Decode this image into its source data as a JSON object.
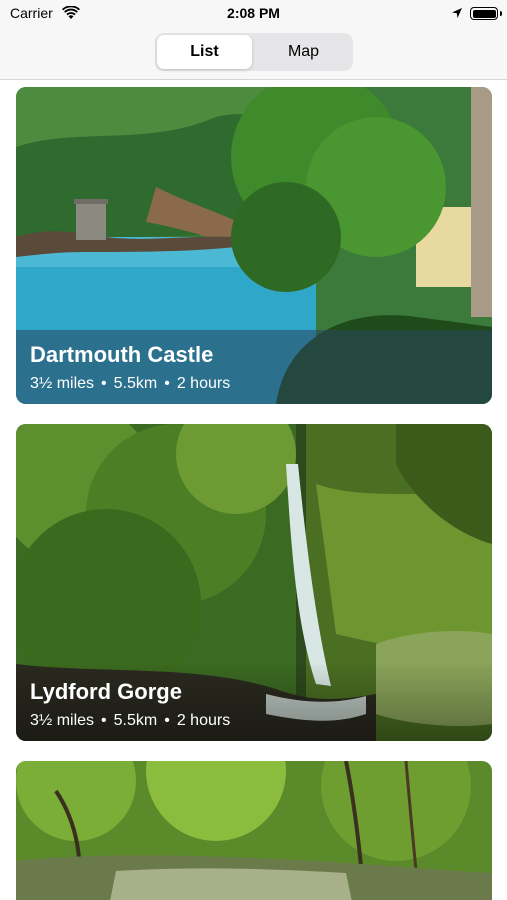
{
  "status_bar": {
    "carrier": "Carrier",
    "time": "2:08 PM"
  },
  "segmented": {
    "options": [
      "List",
      "Map"
    ],
    "selected": "List"
  },
  "walks": [
    {
      "title": "Dartmouth Castle",
      "distance_miles": "3½ miles",
      "distance_km": "5.5km",
      "duration": "2 hours",
      "separator": "•"
    },
    {
      "title": "Lydford Gorge",
      "distance_miles": "3½ miles",
      "distance_km": "5.5km",
      "duration": "2 hours",
      "separator": "•"
    },
    {
      "title": "",
      "distance_miles": "",
      "distance_km": "",
      "duration": ""
    }
  ],
  "colors": {
    "accent_selected_segment": "#ffffff",
    "segment_track": "#e6e6e8"
  },
  "icons": [
    "wifi-icon",
    "location-arrow-icon",
    "battery-icon"
  ]
}
